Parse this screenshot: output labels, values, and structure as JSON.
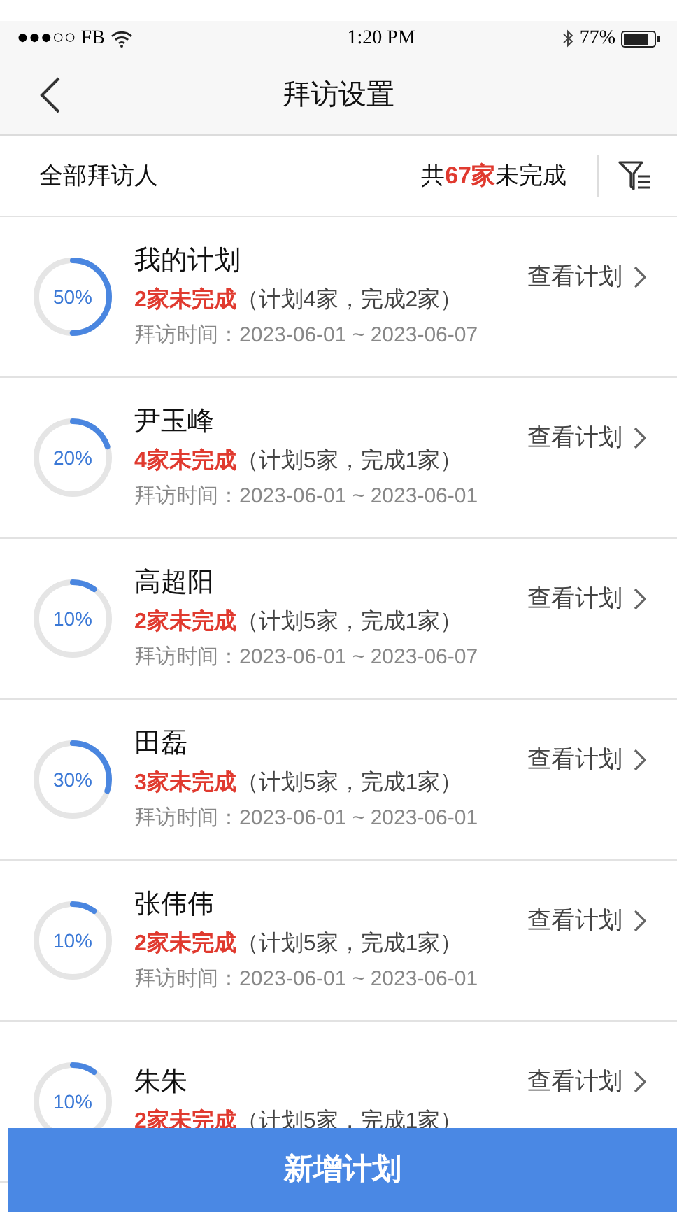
{
  "status_bar": {
    "carrier": "●●●○○ FB",
    "time": "1:20 PM",
    "battery": "77%"
  },
  "nav": {
    "title": "拜访设置"
  },
  "filter_bar": {
    "label": "全部拜访人",
    "summary_prefix": "共",
    "summary_count": "67家",
    "summary_suffix": "未完成"
  },
  "plans": [
    {
      "name": "我的计划",
      "level": 0.5,
      "percent": "50%",
      "pending": "2家未完成",
      "detail": "（计划4家，完成2家）",
      "date": "拜访时间：2023-06-01 ~ 2023-06-07",
      "action": "查看计划"
    },
    {
      "name": "尹玉峰",
      "level": 0.2,
      "percent": "20%",
      "pending": "4家未完成",
      "detail": "（计划5家，完成1家）",
      "date": "拜访时间：2023-06-01 ~ 2023-06-01",
      "action": "查看计划"
    },
    {
      "name": "高超阳",
      "level": 0.1,
      "percent": "10%",
      "pending": "2家未完成",
      "detail": "（计划5家，完成1家）",
      "date": "拜访时间：2023-06-01 ~ 2023-06-07",
      "action": "查看计划"
    },
    {
      "name": "田磊",
      "level": 0.3,
      "percent": "30%",
      "pending": "3家未完成",
      "detail": "（计划5家，完成1家）",
      "date": "拜访时间：2023-06-01 ~ 2023-06-01",
      "action": "查看计划"
    },
    {
      "name": "张伟伟",
      "level": 0.1,
      "percent": "10%",
      "pending": "2家未完成",
      "detail": "（计划5家，完成1家）",
      "date": "拜访时间：2023-06-01 ~ 2023-06-01",
      "action": "查看计划"
    },
    {
      "name": "朱朱",
      "level": 0.1,
      "percent": "10%",
      "pending": "2家未完成",
      "detail": "（计划5家，完成1家）",
      "action": "查看计划"
    }
  ],
  "add_button": "新增计划"
}
